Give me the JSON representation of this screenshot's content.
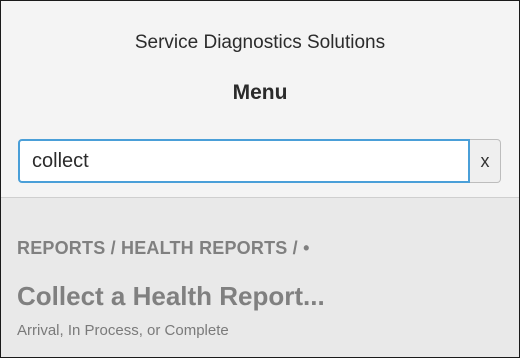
{
  "header": {
    "app_name": "Service Diagnostics Solutions",
    "menu_title": "Menu"
  },
  "search": {
    "value": "collect",
    "clear_label": "x"
  },
  "results": [
    {
      "breadcrumb": "REPORTS / HEALTH REPORTS / •",
      "title": "Collect a Health Report...",
      "description": "Arrival, In Process, or Complete"
    }
  ]
}
